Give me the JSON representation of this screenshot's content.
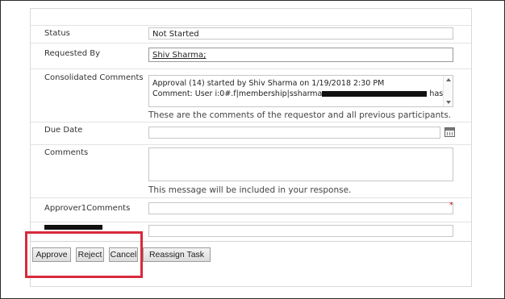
{
  "form": {
    "status": {
      "label": "Status",
      "value": "Not Started"
    },
    "requested_by": {
      "label": "Requested By",
      "value": "Shiv Sharma;"
    },
    "consolidated_comments": {
      "label": "Consolidated Comments",
      "line1": "Approval (14) started by Shiv Sharma on 1/19/2018 2:30 PM",
      "line2_prefix": "Comment: User i:0#.f|membership|ssharma",
      "line2_suffix": "has...",
      "hint": "These are the comments of the requestor and all previous participants."
    },
    "due_date": {
      "label": "Due Date",
      "value": ""
    },
    "comments": {
      "label": "Comments",
      "value": "",
      "hint": "This message will be included in your response."
    },
    "approver1_comments": {
      "label": "Approver1Comments",
      "value": "",
      "required_mark": "*"
    },
    "redacted_field": {
      "value": ""
    }
  },
  "buttons": {
    "approve": "Approve",
    "reject": "Reject",
    "cancel": "Cancel",
    "reassign": "Reassign Task"
  }
}
